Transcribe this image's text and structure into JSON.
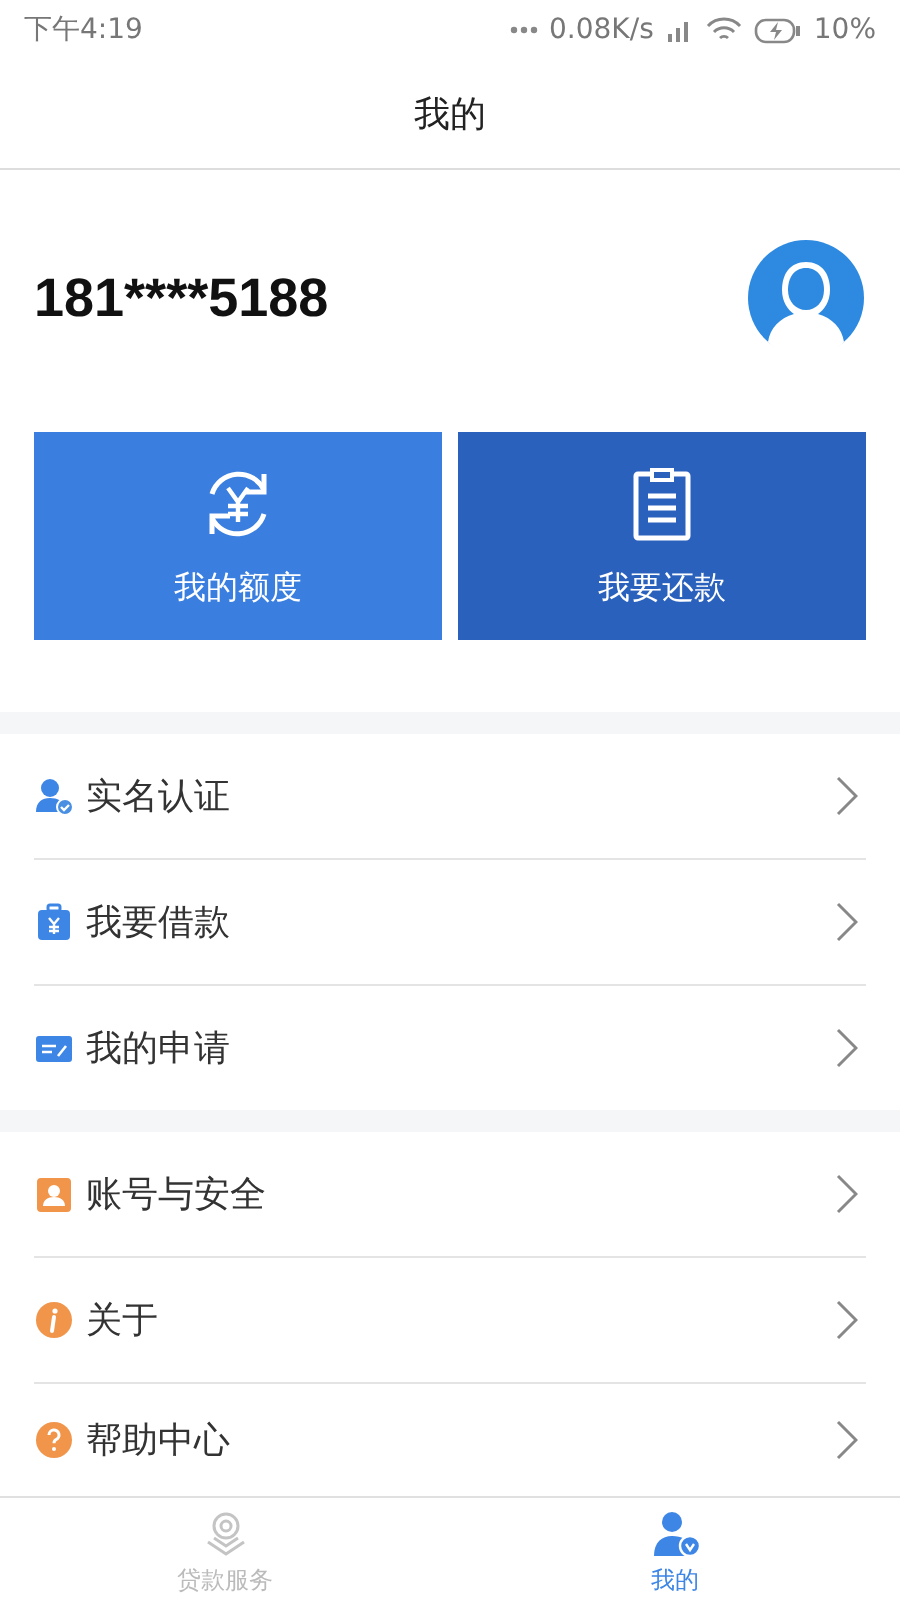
{
  "status_bar": {
    "time": "下午4:19",
    "speed": "0.08K/s",
    "battery": "10%"
  },
  "header": {
    "title": "我的"
  },
  "profile": {
    "phone": "181****5188"
  },
  "actions": [
    {
      "label": "我的额度"
    },
    {
      "label": "我要还款"
    }
  ],
  "menu_groups": [
    [
      {
        "label": "实名认证"
      },
      {
        "label": "我要借款"
      },
      {
        "label": "我的申请"
      }
    ],
    [
      {
        "label": "账号与安全"
      },
      {
        "label": "关于"
      },
      {
        "label": "帮助中心"
      }
    ]
  ],
  "tabs": [
    {
      "label": "贷款服务",
      "selected": false
    },
    {
      "label": "我的",
      "selected": true
    }
  ]
}
